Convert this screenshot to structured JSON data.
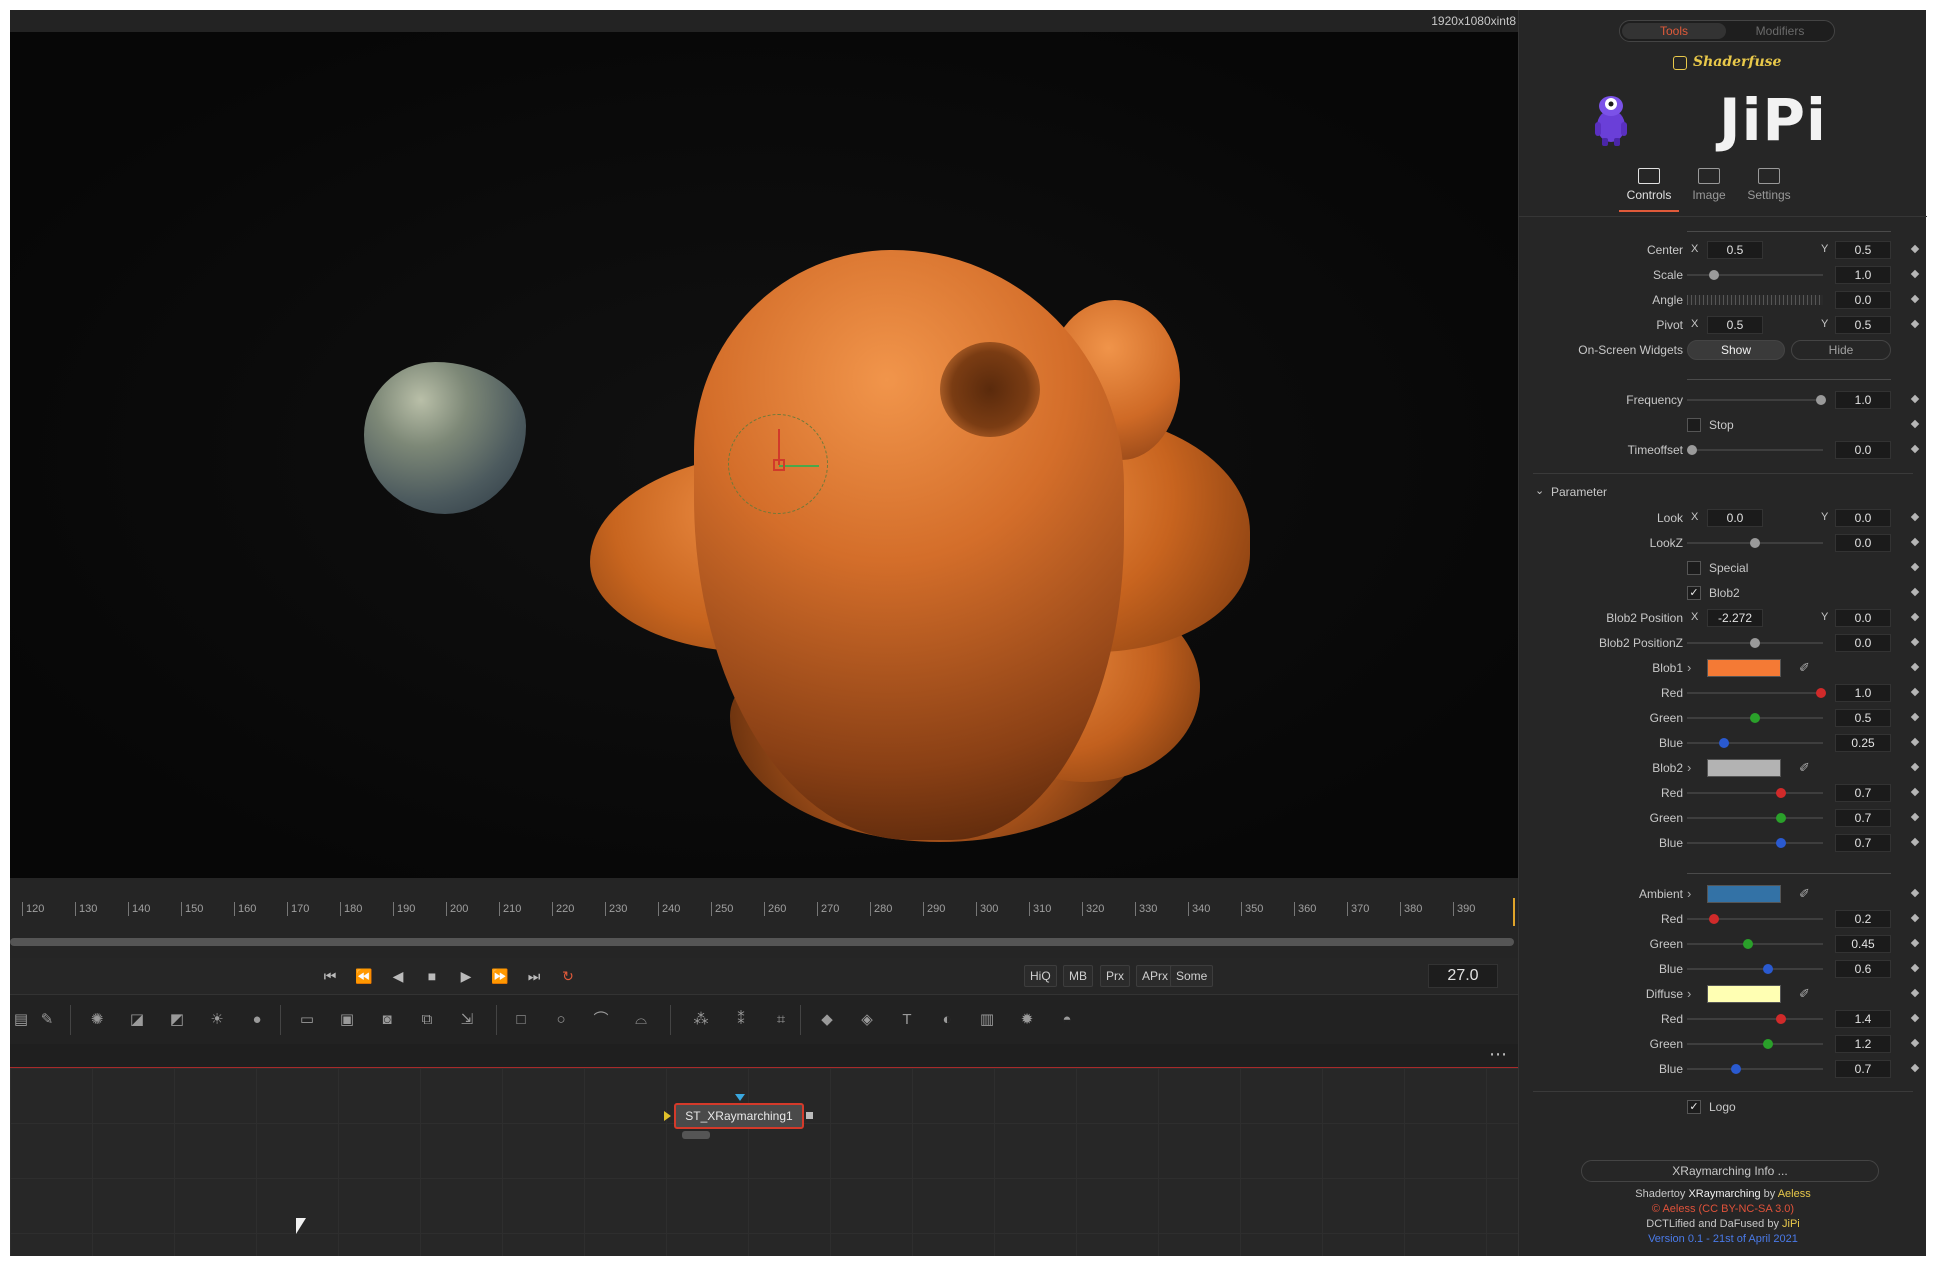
{
  "viewer": {
    "resolution": "1920x1080xint8"
  },
  "timeline": {
    "ticks": [
      "120",
      "130",
      "140",
      "150",
      "160",
      "170",
      "180",
      "190",
      "200",
      "210",
      "220",
      "230",
      "240",
      "250",
      "260",
      "270",
      "280",
      "290",
      "300",
      "310",
      "320",
      "330",
      "340",
      "350",
      "360",
      "370",
      "380",
      "390"
    ],
    "current_frame": "27.0",
    "buttons": [
      "HiQ",
      "MB",
      "Prx",
      "APrx",
      "Some"
    ]
  },
  "flow": {
    "node_label": "ST_XRaymarching1"
  },
  "inspector": {
    "tabs": {
      "tools": "Tools",
      "modifiers": "Modifiers"
    },
    "shaderfuse_label": "Shaderfuse",
    "logo_text": "JiPi",
    "view_tabs": {
      "controls": "Controls",
      "image": "Image",
      "settings": "Settings"
    },
    "center": {
      "label": "Center",
      "x_label": "X",
      "x": "0.5",
      "y_label": "Y",
      "y": "0.5"
    },
    "scale": {
      "label": "Scale",
      "value": "1.0"
    },
    "angle": {
      "label": "Angle",
      "value": "0.0"
    },
    "pivot": {
      "label": "Pivot",
      "x_label": "X",
      "x": "0.5",
      "y_label": "Y",
      "y": "0.5"
    },
    "widgets": {
      "label": "On-Screen Widgets",
      "show": "Show",
      "hide": "Hide"
    },
    "frequency": {
      "label": "Frequency",
      "value": "1.0"
    },
    "stop": {
      "label": "Stop",
      "checked": false
    },
    "timeoffset": {
      "label": "Timeoffset",
      "value": "0.0"
    },
    "parameter_section": "Parameter",
    "look": {
      "label": "Look",
      "x_label": "X",
      "x": "0.0",
      "y_label": "Y",
      "y": "0.0"
    },
    "lookz": {
      "label": "LookZ",
      "value": "0.0"
    },
    "special": {
      "label": "Special",
      "checked": false
    },
    "blob2_check": {
      "label": "Blob2",
      "checked": true
    },
    "blob2_position": {
      "label": "Blob2 Position",
      "x_label": "X",
      "x": "-2.272",
      "y_label": "Y",
      "y": "0.0"
    },
    "blob2_positionz": {
      "label": "Blob2 PositionZ",
      "value": "0.0"
    },
    "blob1": {
      "label": "Blob1",
      "color": "#f47a35",
      "red_label": "Red",
      "red": "1.0",
      "green_label": "Green",
      "green": "0.5",
      "blue_label": "Blue",
      "blue": "0.25"
    },
    "blob2": {
      "label": "Blob2",
      "color": "#b3b3b3",
      "red_label": "Red",
      "red": "0.7",
      "green_label": "Green",
      "green": "0.7",
      "blue_label": "Blue",
      "blue": "0.7"
    },
    "ambient": {
      "label": "Ambient",
      "color": "#3372a6",
      "red_label": "Red",
      "red": "0.2",
      "green_label": "Green",
      "green": "0.45",
      "blue_label": "Blue",
      "blue": "0.6"
    },
    "diffuse": {
      "label": "Diffuse",
      "color": "#ffffb3",
      "red_label": "Red",
      "red": "1.4",
      "green_label": "Green",
      "green": "1.2",
      "blue_label": "Blue",
      "blue": "0.7"
    },
    "logo_check": {
      "label": "Logo",
      "checked": true
    },
    "info_button": "XRaymarching Info ...",
    "credits": {
      "l1_a": "Shadertoy ",
      "l1_b": "XRaymarching",
      "l1_c": " by ",
      "l1_d": "Aeless",
      "l2": "© Aeless (CC BY-NC-SA 3.0)",
      "l3_a": "DCTLified and DaFused by ",
      "l3_b": "JiPi",
      "l4": "Version 0.1 - 21st of April 2021"
    }
  },
  "colors": {
    "accent": "#e05a3a",
    "highlight_yellow": "#e8c84a",
    "link_blue": "#4a7ae8",
    "credit_red": "#e0523a"
  }
}
